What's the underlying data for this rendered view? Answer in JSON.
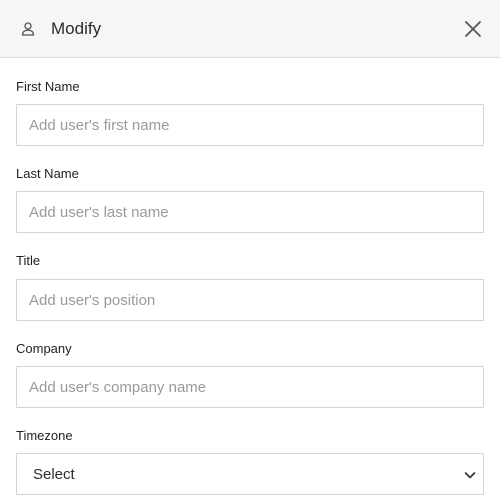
{
  "header": {
    "title": "Modify",
    "icon": "user-icon",
    "close_icon": "close-icon"
  },
  "form": {
    "first_name": {
      "label": "First Name",
      "value": "",
      "placeholder": "Add user's first name"
    },
    "last_name": {
      "label": "Last Name",
      "value": "",
      "placeholder": "Add user's last name"
    },
    "title": {
      "label": "Title",
      "value": "",
      "placeholder": "Add user's position"
    },
    "company": {
      "label": "Company",
      "value": "",
      "placeholder": "Add user's company name"
    },
    "timezone": {
      "label": "Timezone",
      "selected": "Select",
      "icon": "chevron-down-icon"
    }
  },
  "colors": {
    "header_bg": "#f6f6f6",
    "border": "#d4d4d4",
    "text": "#222222",
    "placeholder": "#9a9a9a"
  }
}
